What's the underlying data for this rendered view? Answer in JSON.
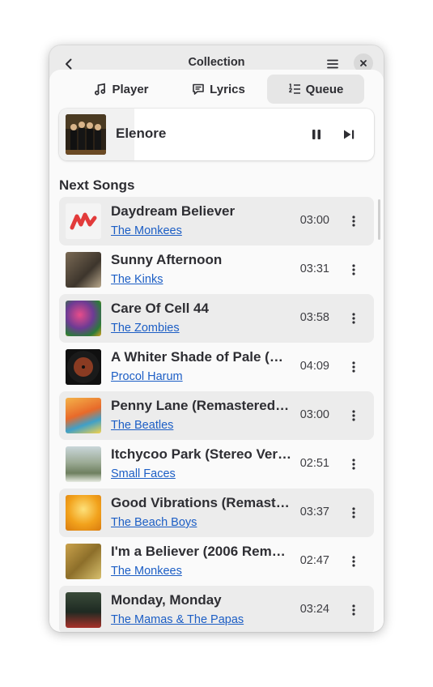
{
  "header": {
    "title": "Collection"
  },
  "tabs": [
    {
      "label": "Player",
      "icon": "music-note-icon"
    },
    {
      "label": "Lyrics",
      "icon": "speech-bubble-icon"
    },
    {
      "label": "Queue",
      "icon": "queue-list-icon",
      "active": true
    }
  ],
  "now_playing": {
    "title": "Elenore",
    "progress": 0.24
  },
  "queue": {
    "heading": "Next Songs",
    "songs": [
      {
        "title": "Daydream Believer",
        "artist": "The Monkees",
        "duration": "03:00",
        "art": "art-monkees"
      },
      {
        "title": "Sunny Afternoon",
        "artist": "The Kinks",
        "duration": "03:31",
        "art": "art-kinks"
      },
      {
        "title": "Care Of Cell 44",
        "artist": "The Zombies",
        "duration": "03:58",
        "art": "art-zombies"
      },
      {
        "title": "A Whiter Shade of Pale (…",
        "artist": "Procol Harum",
        "duration": "04:09",
        "art": "art-procol"
      },
      {
        "title": "Penny Lane (Remastered…",
        "artist": "The Beatles",
        "duration": "03:00",
        "art": "art-beatles"
      },
      {
        "title": "Itchycoo Park (Stereo Ver…",
        "artist": "Small Faces",
        "duration": "02:51",
        "art": "art-faces"
      },
      {
        "title": "Good Vibrations (Remast…",
        "artist": "The Beach Boys",
        "duration": "03:37",
        "art": "art-beachboys"
      },
      {
        "title": "I'm a Believer (2006 Rem…",
        "artist": "The Monkees",
        "duration": "02:47",
        "art": "art-believer"
      },
      {
        "title": "Monday, Monday",
        "artist": "The Mamas & The Papas",
        "duration": "03:24",
        "art": "art-mamas"
      }
    ]
  },
  "colors": {
    "accent_link": "#1c5ec5",
    "row_alt": "#ececec",
    "window_bg": "#ebebeb"
  }
}
